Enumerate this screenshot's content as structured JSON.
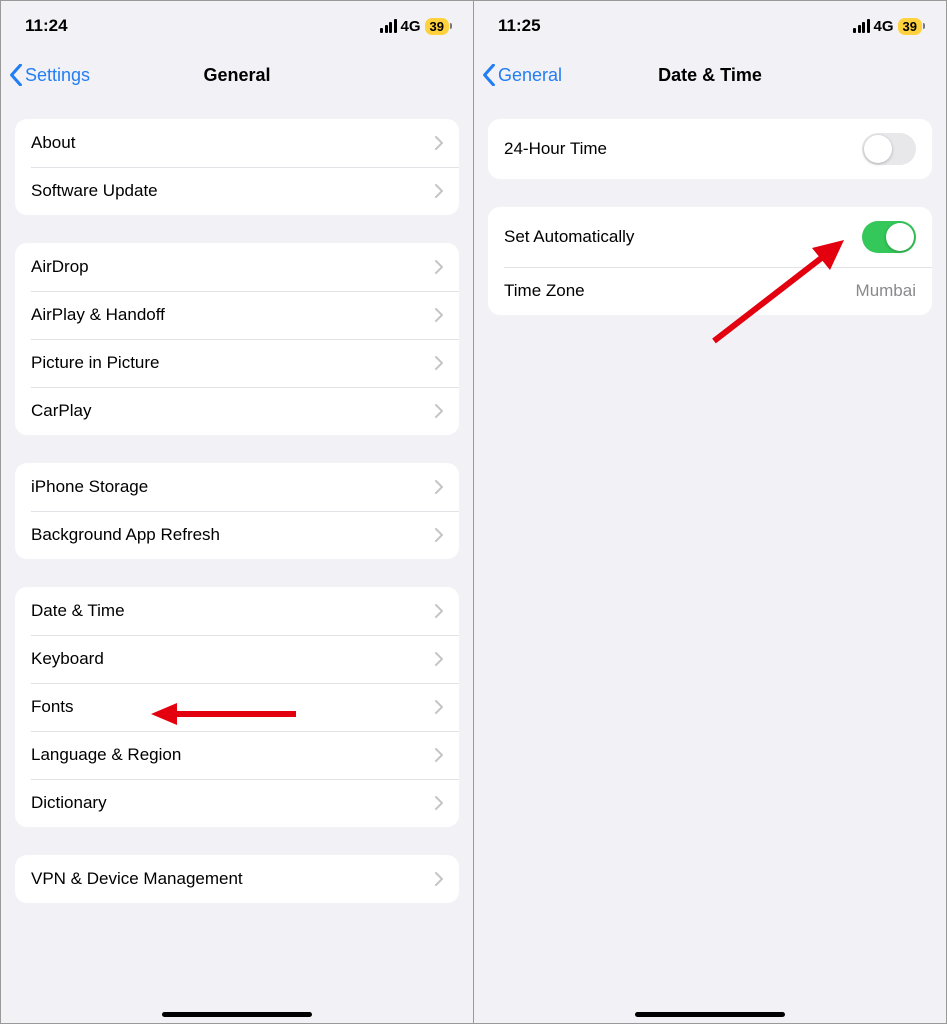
{
  "left": {
    "status": {
      "time": "11:24",
      "network": "4G",
      "battery": "39"
    },
    "nav": {
      "back_label": "Settings",
      "title": "General"
    },
    "groups": [
      {
        "items": [
          {
            "label": "About"
          },
          {
            "label": "Software Update"
          }
        ]
      },
      {
        "items": [
          {
            "label": "AirDrop"
          },
          {
            "label": "AirPlay & Handoff"
          },
          {
            "label": "Picture in Picture"
          },
          {
            "label": "CarPlay"
          }
        ]
      },
      {
        "items": [
          {
            "label": "iPhone Storage"
          },
          {
            "label": "Background App Refresh"
          }
        ]
      },
      {
        "items": [
          {
            "label": "Date & Time"
          },
          {
            "label": "Keyboard"
          },
          {
            "label": "Fonts"
          },
          {
            "label": "Language & Region"
          },
          {
            "label": "Dictionary"
          }
        ]
      },
      {
        "items": [
          {
            "label": "VPN & Device Management"
          }
        ]
      }
    ]
  },
  "right": {
    "status": {
      "time": "11:25",
      "network": "4G",
      "battery": "39"
    },
    "nav": {
      "back_label": "General",
      "title": "Date & Time"
    },
    "rows": {
      "twentyfour": {
        "label": "24-Hour Time",
        "on": false
      },
      "auto": {
        "label": "Set Automatically",
        "on": true
      },
      "tz": {
        "label": "Time Zone",
        "value": "Mumbai"
      }
    }
  }
}
